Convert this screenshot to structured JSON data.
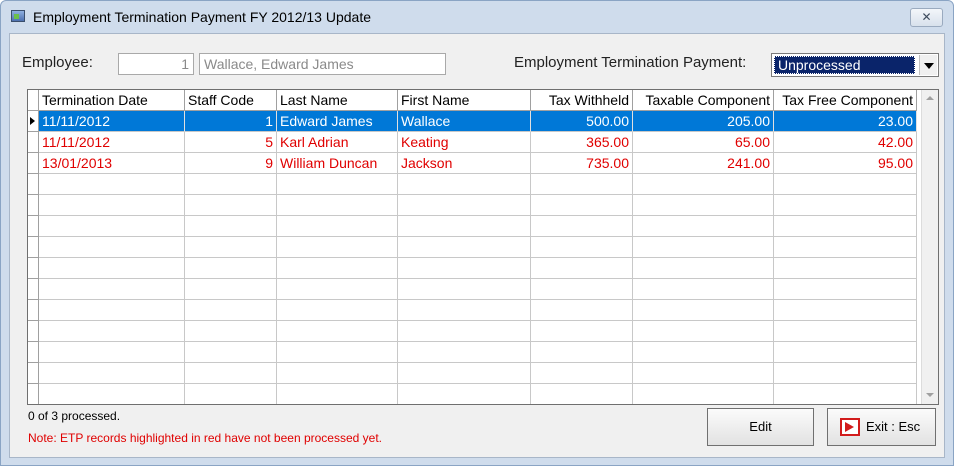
{
  "window": {
    "title": "Employment Termination Payment FY 2012/13 Update",
    "close_glyph": "✕"
  },
  "filters": {
    "employee_label": "Employee:",
    "employee_id": "1",
    "employee_name": "Wallace, Edward James",
    "etp_label": "Employment Termination Payment:",
    "etp_selected": "Unprocessed"
  },
  "grid": {
    "columns": [
      "Termination Date",
      "Staff Code",
      "Last Name",
      "First Name",
      "Tax Withheld",
      "Taxable Component",
      "Tax Free Component"
    ],
    "rows": [
      [
        "11/11/2012",
        "1",
        "Edward James",
        "Wallace",
        "500.00",
        "205.00",
        "23.00"
      ],
      [
        "11/11/2012",
        "5",
        "Karl Adrian",
        "Keating",
        "365.00",
        "65.00",
        "42.00"
      ],
      [
        "13/01/2013",
        "9",
        "William Duncan",
        "Jackson",
        "735.00",
        "241.00",
        "95.00"
      ]
    ],
    "selected_row": 0
  },
  "status": {
    "processed_text": "0 of 3 processed.",
    "note_text": "Note: ETP records highlighted in red have not been processed yet."
  },
  "buttons": {
    "edit_label": "Edit",
    "exit_label": "Exit : Esc"
  },
  "colors": {
    "unprocessed": "#e00000",
    "selection": "#0078d7"
  }
}
